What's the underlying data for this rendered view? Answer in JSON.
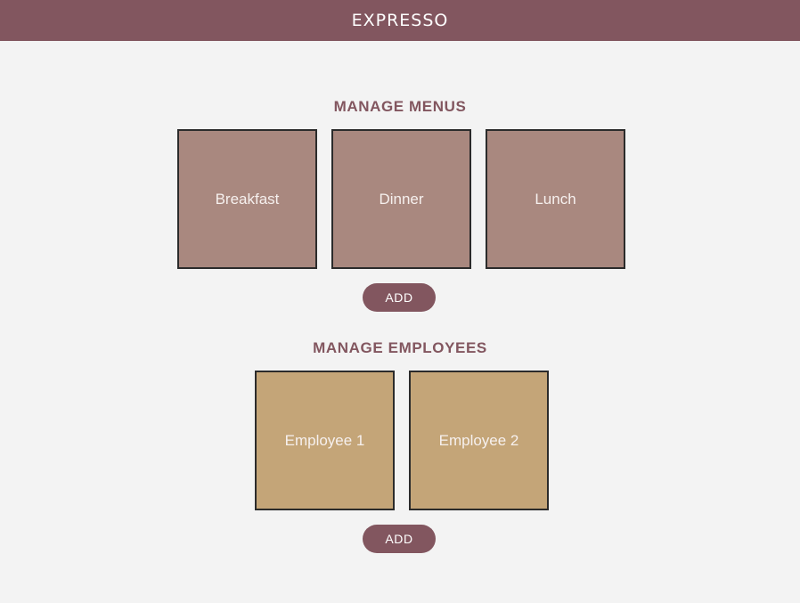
{
  "header": {
    "logo": "EXPRESSO"
  },
  "menus": {
    "title": "MANAGE MENUS",
    "items": [
      "Breakfast",
      "Dinner",
      "Lunch"
    ],
    "add_label": "ADD"
  },
  "employees": {
    "title": "MANAGE EMPLOYEES",
    "items": [
      "Employee 1",
      "Employee 2"
    ],
    "add_label": "ADD"
  },
  "colors": {
    "brand": "#82565f",
    "background": "#f3f3f3",
    "menu_card": "#a9887f",
    "employee_card": "#c4a578"
  }
}
